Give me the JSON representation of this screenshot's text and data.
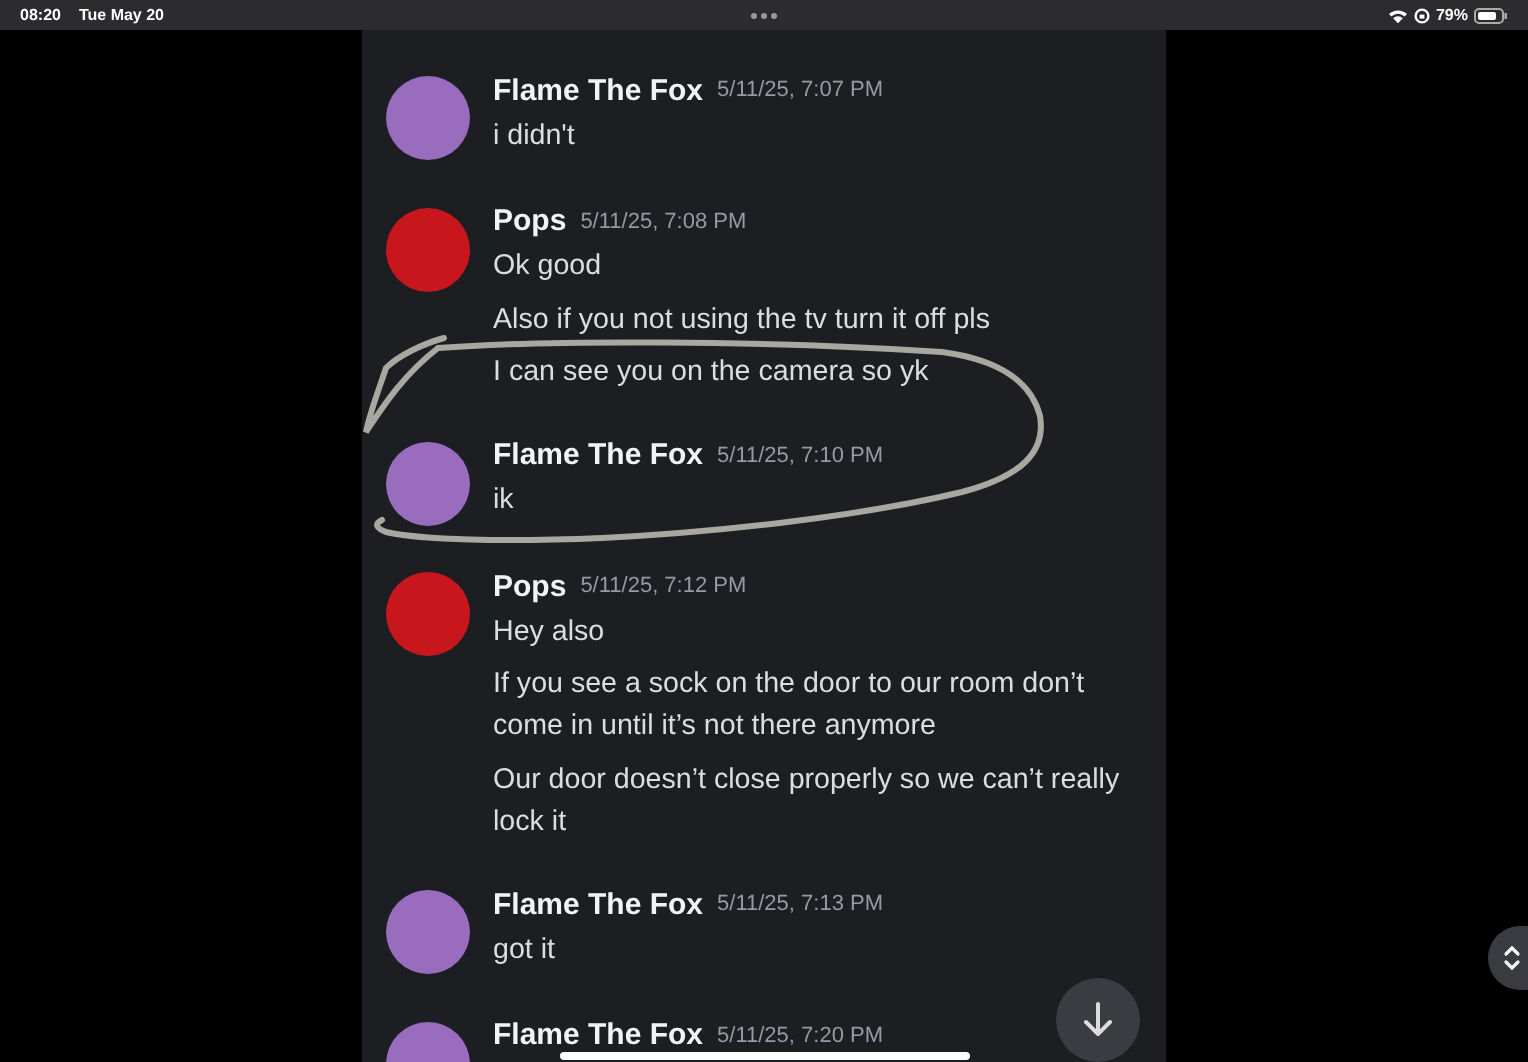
{
  "status_bar": {
    "time": "08:20",
    "date": "Tue May 20",
    "battery": "79%"
  },
  "messages": [
    {
      "author": "Flame The Fox",
      "timestamp": "5/11/25, 7:07 PM",
      "color": "#9a6cbd",
      "lines": [
        "i didn't"
      ]
    },
    {
      "author": "Pops",
      "timestamp": "5/11/25, 7:08 PM",
      "color": "#c8161d",
      "lines": [
        "Ok good",
        "Also if you not using the tv turn it off pls",
        "I can see you on the camera so yk"
      ]
    },
    {
      "author": "Flame The Fox",
      "timestamp": "5/11/25, 7:10 PM",
      "color": "#9a6cbd",
      "lines": [
        "ik"
      ]
    },
    {
      "author": "Pops",
      "timestamp": "5/11/25, 7:12 PM",
      "color": "#c8161d",
      "lines": [
        "Hey also",
        "If you see a sock on the door to our room don’t come in until it’s not there anymore",
        "Our door doesn’t close properly so we can’t really lock it"
      ]
    },
    {
      "author": "Flame The Fox",
      "timestamp": "5/11/25, 7:13 PM",
      "color": "#9a6cbd",
      "lines": [
        "got it"
      ]
    },
    {
      "author": "Flame The Fox",
      "timestamp": "5/11/25, 7:20 PM",
      "color": "#9a6cbd"
    }
  ]
}
